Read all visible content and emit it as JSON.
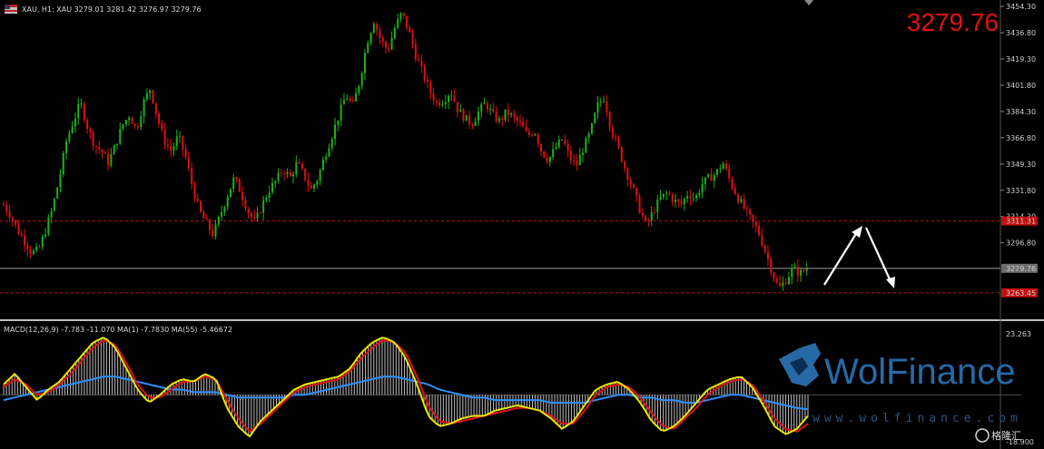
{
  "header": {
    "symbol_line": "XAU, H1:  XAU  3279.01 3281.42 3276.97 3279.76",
    "big_price": "3279.76"
  },
  "macd_label": "MACD(12,26,9) -7.783 -11.070 MA(1) -7.7830 MA(55) -5.46672",
  "watermark": {
    "brand": "WolFinance",
    "url": "www.wolfinance.com",
    "badge": "格隆汇"
  },
  "levels": {
    "current": "3279.76",
    "resistance": "3311.31",
    "support": "3263.45"
  },
  "colors": {
    "bull": "#1bb31b",
    "bear": "#e01010",
    "macd_fast": "#e8e800",
    "macd_signal": "#e01010",
    "macd_ma": "#2f8fff",
    "level_line": "#c01010"
  },
  "chart_data": [
    {
      "type": "candlestick",
      "title": "XAU, H1",
      "y_ticks": [
        "3454.30",
        "3436.80",
        "3419.30",
        "3401.80",
        "3384.30",
        "3366.80",
        "3349.30",
        "3331.80",
        "3314.30",
        "3296.80"
      ],
      "ylim": [
        3247,
        3455
      ],
      "current_price": 3279.76,
      "horizontal_levels": [
        3311.31,
        3263.45
      ],
      "close_path": [
        3322,
        3315,
        3305,
        3298,
        3290,
        3292,
        3305,
        3320,
        3340,
        3365,
        3378,
        3390,
        3374,
        3362,
        3358,
        3350,
        3362,
        3375,
        3382,
        3372,
        3390,
        3400,
        3380,
        3365,
        3358,
        3368,
        3355,
        3335,
        3318,
        3310,
        3302,
        3315,
        3328,
        3340,
        3330,
        3318,
        3310,
        3322,
        3332,
        3338,
        3346,
        3340,
        3350,
        3342,
        3332,
        3340,
        3355,
        3368,
        3382,
        3395,
        3388,
        3405,
        3430,
        3445,
        3432,
        3425,
        3440,
        3450,
        3438,
        3422,
        3410,
        3398,
        3390,
        3392,
        3398,
        3386,
        3380,
        3376,
        3384,
        3390,
        3382,
        3378,
        3384,
        3380,
        3376,
        3368,
        3372,
        3358,
        3352,
        3360,
        3366,
        3354,
        3348,
        3360,
        3370,
        3388,
        3394,
        3372,
        3360,
        3346,
        3334,
        3320,
        3308,
        3318,
        3326,
        3330,
        3325,
        3322,
        3330,
        3326,
        3336,
        3340,
        3343,
        3350,
        3338,
        3328,
        3320,
        3312,
        3305,
        3292,
        3278,
        3266,
        3272,
        3280,
        3276,
        3279.76
      ],
      "annotation": "projected path: 3279 -> 3311 -> 3264"
    },
    {
      "type": "line",
      "title": "MACD(12,26,9)",
      "y_ticks": [
        "23.263",
        "-18.900"
      ],
      "ylim": [
        -18.9,
        23.263
      ],
      "series": [
        {
          "name": "MACD",
          "values": [
            4,
            8,
            3,
            -2,
            2,
            5,
            10,
            15,
            20,
            22,
            18,
            10,
            2,
            -3,
            0,
            4,
            6,
            5,
            8,
            6,
            -5,
            -12,
            -16,
            -10,
            -6,
            -2,
            2,
            4,
            5,
            6,
            7,
            10,
            16,
            20,
            22,
            20,
            14,
            4,
            -8,
            -12,
            -11,
            -9,
            -8,
            -8,
            -6,
            -5,
            -4,
            -5,
            -6,
            -9,
            -13,
            -10,
            -4,
            2,
            4,
            5,
            2,
            -3,
            -10,
            -14,
            -12,
            -8,
            -3,
            2,
            4,
            6,
            7,
            3,
            -4,
            -12,
            -15,
            -13,
            -8
          ]
        },
        {
          "name": "Signal",
          "values": [
            3,
            6,
            4,
            0,
            1,
            4,
            8,
            13,
            18,
            21,
            19,
            12,
            4,
            -1,
            -1,
            2,
            5,
            5,
            7,
            6,
            -2,
            -9,
            -14,
            -11,
            -7,
            -3,
            1,
            3,
            4,
            5,
            6,
            9,
            14,
            18,
            21,
            20,
            16,
            7,
            -4,
            -10,
            -11,
            -10,
            -9,
            -8,
            -7,
            -6,
            -5,
            -5,
            -6,
            -8,
            -11,
            -11,
            -6,
            0,
            3,
            4,
            3,
            -1,
            -7,
            -12,
            -13,
            -9,
            -5,
            0,
            3,
            5,
            6,
            4,
            -2,
            -9,
            -13,
            -14,
            -11
          ]
        },
        {
          "name": "MA(55)",
          "values": [
            -2,
            -1,
            0,
            1,
            2,
            3,
            4,
            5,
            6,
            7,
            7,
            6,
            5,
            4,
            3,
            2,
            2,
            1,
            1,
            1,
            0,
            -1,
            -1,
            -1,
            -1,
            -1,
            0,
            0,
            1,
            2,
            3,
            4,
            5,
            6,
            7,
            7,
            6,
            5,
            4,
            2,
            1,
            0,
            -1,
            -1,
            -2,
            -2,
            -2,
            -2,
            -2,
            -3,
            -3,
            -3,
            -3,
            -2,
            -1,
            0,
            0,
            -1,
            -1,
            -2,
            -2,
            -3,
            -3,
            -2,
            -1,
            0,
            0,
            -1,
            -2,
            -3,
            -4,
            -5,
            -5.47
          ]
        }
      ]
    }
  ]
}
